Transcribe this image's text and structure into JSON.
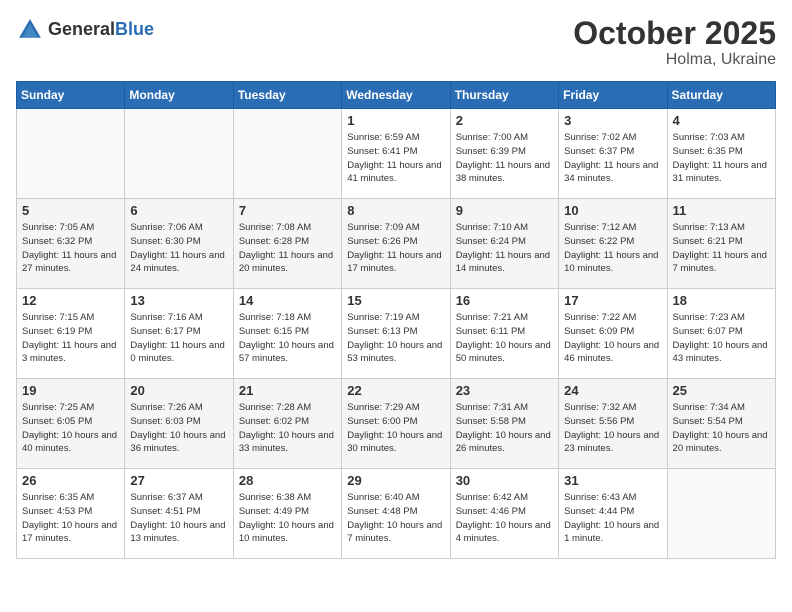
{
  "header": {
    "logo_general": "General",
    "logo_blue": "Blue",
    "month": "October 2025",
    "location": "Holma, Ukraine"
  },
  "weekdays": [
    "Sunday",
    "Monday",
    "Tuesday",
    "Wednesday",
    "Thursday",
    "Friday",
    "Saturday"
  ],
  "weeks": [
    [
      {
        "day": "",
        "info": ""
      },
      {
        "day": "",
        "info": ""
      },
      {
        "day": "",
        "info": ""
      },
      {
        "day": "1",
        "info": "Sunrise: 6:59 AM\nSunset: 6:41 PM\nDaylight: 11 hours and 41 minutes."
      },
      {
        "day": "2",
        "info": "Sunrise: 7:00 AM\nSunset: 6:39 PM\nDaylight: 11 hours and 38 minutes."
      },
      {
        "day": "3",
        "info": "Sunrise: 7:02 AM\nSunset: 6:37 PM\nDaylight: 11 hours and 34 minutes."
      },
      {
        "day": "4",
        "info": "Sunrise: 7:03 AM\nSunset: 6:35 PM\nDaylight: 11 hours and 31 minutes."
      }
    ],
    [
      {
        "day": "5",
        "info": "Sunrise: 7:05 AM\nSunset: 6:32 PM\nDaylight: 11 hours and 27 minutes."
      },
      {
        "day": "6",
        "info": "Sunrise: 7:06 AM\nSunset: 6:30 PM\nDaylight: 11 hours and 24 minutes."
      },
      {
        "day": "7",
        "info": "Sunrise: 7:08 AM\nSunset: 6:28 PM\nDaylight: 11 hours and 20 minutes."
      },
      {
        "day": "8",
        "info": "Sunrise: 7:09 AM\nSunset: 6:26 PM\nDaylight: 11 hours and 17 minutes."
      },
      {
        "day": "9",
        "info": "Sunrise: 7:10 AM\nSunset: 6:24 PM\nDaylight: 11 hours and 14 minutes."
      },
      {
        "day": "10",
        "info": "Sunrise: 7:12 AM\nSunset: 6:22 PM\nDaylight: 11 hours and 10 minutes."
      },
      {
        "day": "11",
        "info": "Sunrise: 7:13 AM\nSunset: 6:21 PM\nDaylight: 11 hours and 7 minutes."
      }
    ],
    [
      {
        "day": "12",
        "info": "Sunrise: 7:15 AM\nSunset: 6:19 PM\nDaylight: 11 hours and 3 minutes."
      },
      {
        "day": "13",
        "info": "Sunrise: 7:16 AM\nSunset: 6:17 PM\nDaylight: 11 hours and 0 minutes."
      },
      {
        "day": "14",
        "info": "Sunrise: 7:18 AM\nSunset: 6:15 PM\nDaylight: 10 hours and 57 minutes."
      },
      {
        "day": "15",
        "info": "Sunrise: 7:19 AM\nSunset: 6:13 PM\nDaylight: 10 hours and 53 minutes."
      },
      {
        "day": "16",
        "info": "Sunrise: 7:21 AM\nSunset: 6:11 PM\nDaylight: 10 hours and 50 minutes."
      },
      {
        "day": "17",
        "info": "Sunrise: 7:22 AM\nSunset: 6:09 PM\nDaylight: 10 hours and 46 minutes."
      },
      {
        "day": "18",
        "info": "Sunrise: 7:23 AM\nSunset: 6:07 PM\nDaylight: 10 hours and 43 minutes."
      }
    ],
    [
      {
        "day": "19",
        "info": "Sunrise: 7:25 AM\nSunset: 6:05 PM\nDaylight: 10 hours and 40 minutes."
      },
      {
        "day": "20",
        "info": "Sunrise: 7:26 AM\nSunset: 6:03 PM\nDaylight: 10 hours and 36 minutes."
      },
      {
        "day": "21",
        "info": "Sunrise: 7:28 AM\nSunset: 6:02 PM\nDaylight: 10 hours and 33 minutes."
      },
      {
        "day": "22",
        "info": "Sunrise: 7:29 AM\nSunset: 6:00 PM\nDaylight: 10 hours and 30 minutes."
      },
      {
        "day": "23",
        "info": "Sunrise: 7:31 AM\nSunset: 5:58 PM\nDaylight: 10 hours and 26 minutes."
      },
      {
        "day": "24",
        "info": "Sunrise: 7:32 AM\nSunset: 5:56 PM\nDaylight: 10 hours and 23 minutes."
      },
      {
        "day": "25",
        "info": "Sunrise: 7:34 AM\nSunset: 5:54 PM\nDaylight: 10 hours and 20 minutes."
      }
    ],
    [
      {
        "day": "26",
        "info": "Sunrise: 6:35 AM\nSunset: 4:53 PM\nDaylight: 10 hours and 17 minutes."
      },
      {
        "day": "27",
        "info": "Sunrise: 6:37 AM\nSunset: 4:51 PM\nDaylight: 10 hours and 13 minutes."
      },
      {
        "day": "28",
        "info": "Sunrise: 6:38 AM\nSunset: 4:49 PM\nDaylight: 10 hours and 10 minutes."
      },
      {
        "day": "29",
        "info": "Sunrise: 6:40 AM\nSunset: 4:48 PM\nDaylight: 10 hours and 7 minutes."
      },
      {
        "day": "30",
        "info": "Sunrise: 6:42 AM\nSunset: 4:46 PM\nDaylight: 10 hours and 4 minutes."
      },
      {
        "day": "31",
        "info": "Sunrise: 6:43 AM\nSunset: 4:44 PM\nDaylight: 10 hours and 1 minute."
      },
      {
        "day": "",
        "info": ""
      }
    ]
  ]
}
